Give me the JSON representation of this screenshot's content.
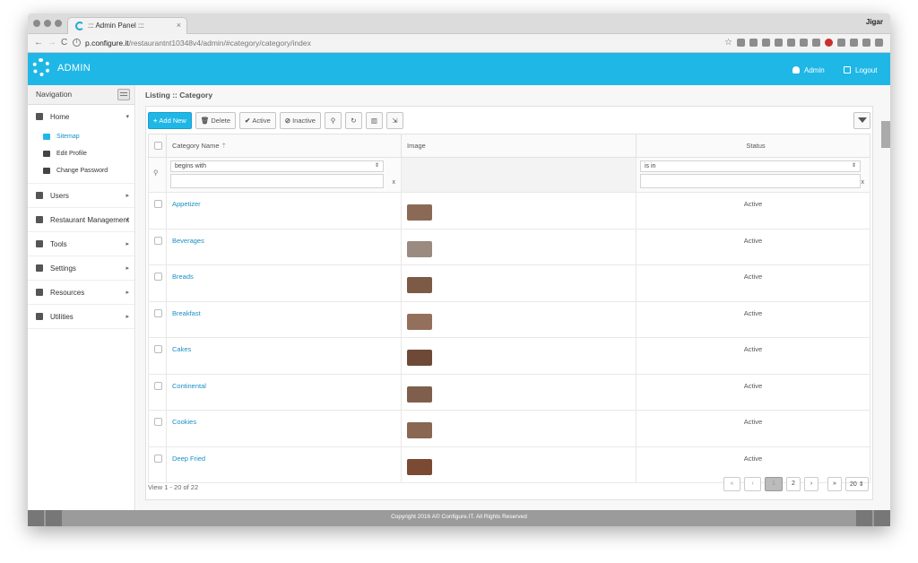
{
  "browser": {
    "tab_title": "::: Admin Panel :::",
    "tab_close": "×",
    "profile": "Jigar",
    "url_host": "p.configure.it",
    "url_path": "/restaurantnt10348v4/admin/#category/category/index",
    "url_info": "i",
    "nav_back": "←",
    "nav_forward": "→",
    "nav_reload": "C",
    "bookmark_star": "☆"
  },
  "header": {
    "title": "ADMIN",
    "user_label": "Admin",
    "logout_label": "Logout"
  },
  "sidebar": {
    "heading": "Navigation",
    "home": "Home",
    "home_subitems": [
      "Sitemap",
      "Edit Profile",
      "Change Password"
    ],
    "items": [
      "Users",
      "Restaurant Management",
      "Tools",
      "Settings",
      "Resources",
      "Utilities"
    ],
    "caret": "▸",
    "caret_down": "▾"
  },
  "page": {
    "title": "Listing :: Category"
  },
  "toolbar": {
    "add_new": "Add New",
    "delete": "Delete",
    "active": "Active",
    "inactive": "Inactive",
    "plus_glyph": "+",
    "delete_glyph": "🗑",
    "check_glyph": "✔",
    "ban_glyph": "⊘",
    "search_glyph": "⚲",
    "refresh_glyph": "↻",
    "columns_glyph": "▥",
    "export_glyph": "⇲"
  },
  "grid": {
    "columns": [
      "Category Name",
      "Image",
      "Status"
    ],
    "sort_glyph": "⇡",
    "filter_name_op": "begins with",
    "filter_status_op": "is in",
    "filter_glyph": "⚲",
    "clear_glyph": "x",
    "select_arrow": "⇕",
    "rows": [
      {
        "name": "Appetizer",
        "status": "Active",
        "thumb_color": "#8a6a56"
      },
      {
        "name": "Beverages",
        "status": "Active",
        "thumb_color": "#9a8a80"
      },
      {
        "name": "Breads",
        "status": "Active",
        "thumb_color": "#7c5a45"
      },
      {
        "name": "Breakfast",
        "status": "Active",
        "thumb_color": "#93705b"
      },
      {
        "name": "Cakes",
        "status": "Active",
        "thumb_color": "#6e4a36"
      },
      {
        "name": "Continental",
        "status": "Active",
        "thumb_color": "#7f5f4b"
      },
      {
        "name": "Cookies",
        "status": "Active",
        "thumb_color": "#896752"
      },
      {
        "name": "Deep Fried",
        "status": "Active",
        "thumb_color": "#7a4a33"
      }
    ]
  },
  "pager": {
    "info": "View 1 - 20 of 22",
    "first": "«",
    "prev": "‹",
    "current": "1",
    "page2": "2",
    "next": "›",
    "last": "»",
    "page_size": "20",
    "size_arrow": "⇕"
  },
  "footer": {
    "text": "Copyright 2016 A© Configure.IT. All Rights Reserved"
  }
}
